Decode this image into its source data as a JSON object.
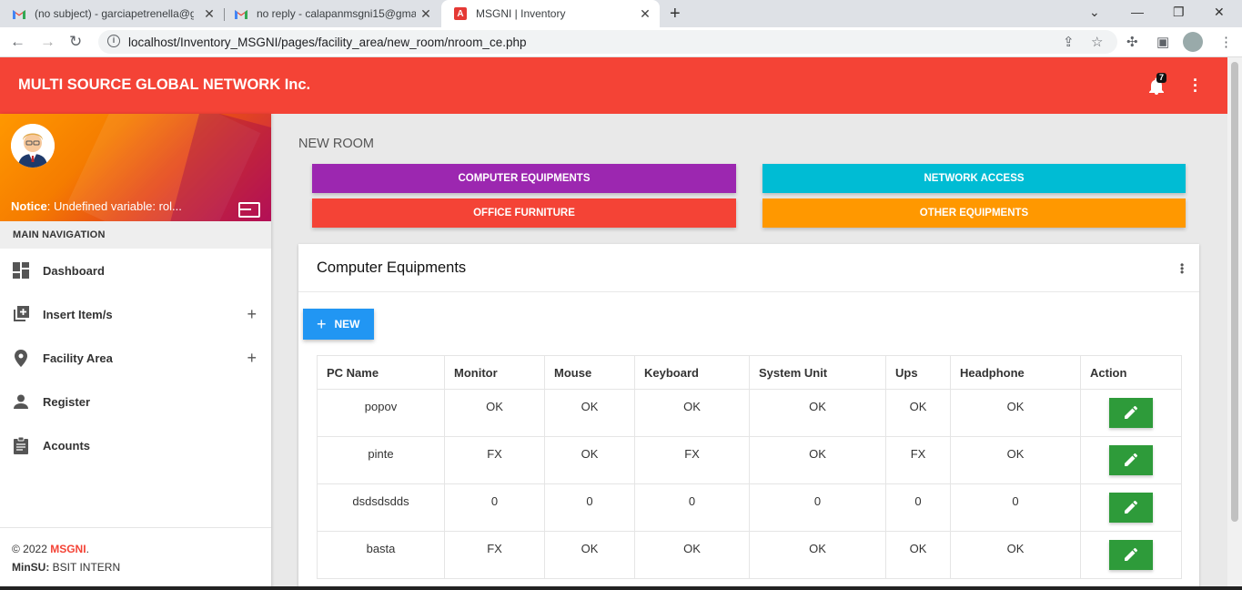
{
  "browser": {
    "tabs": [
      {
        "title": "(no subject) - garciapetrenella@g",
        "icon": "gmail-icon"
      },
      {
        "title": "no reply - calapanmsgni15@gma",
        "icon": "gmail-icon"
      },
      {
        "title": "MSGNI | Inventory",
        "icon": "app-favicon",
        "active": true
      }
    ],
    "url": "localhost/Inventory_MSGNI/pages/facility_area/new_room/nroom_ce.php"
  },
  "header": {
    "brand": "MULTI SOURCE GLOBAL NETWORK Inc.",
    "notification_count": "7",
    "color": "#f44336"
  },
  "sidebar": {
    "notice_label": "Notice",
    "notice_text": ": Undefined variable: rol...",
    "nav_header": "MAIN NAVIGATION",
    "items": [
      {
        "label": "Dashboard",
        "icon": "dashboard-icon",
        "expandable": false
      },
      {
        "label": "Insert Item/s",
        "icon": "library-add-icon",
        "expandable": true
      },
      {
        "label": "Facility Area",
        "icon": "location-pin-icon",
        "expandable": true
      },
      {
        "label": "Register",
        "icon": "person-icon",
        "expandable": false
      },
      {
        "label": "Acounts",
        "icon": "clipboard-icon",
        "expandable": false
      }
    ],
    "footer": {
      "copyright": "© 2022 ",
      "brand": "MSGNI",
      "period": ".",
      "school_label": "MinSU:",
      "school_text": " BSIT INTERN"
    }
  },
  "main": {
    "page_title": "NEW ROOM",
    "categories": [
      {
        "label": "COMPUTER EQUIPMENTS",
        "color": "#9c27b0"
      },
      {
        "label": "NETWORK ACCESS",
        "color": "#00bcd4"
      },
      {
        "label": "OFFICE FURNITURE",
        "color": "#f44336"
      },
      {
        "label": "OTHER EQUIPMENTS",
        "color": "#ff9800"
      }
    ],
    "card": {
      "title": "Computer Equipments",
      "new_button": "NEW",
      "columns": [
        "PC Name",
        "Monitor",
        "Mouse",
        "Keyboard",
        "System Unit",
        "Ups",
        "Headphone",
        "Action"
      ],
      "rows": [
        [
          "popov",
          "OK",
          "OK",
          "OK",
          "OK",
          "OK",
          "OK"
        ],
        [
          "pinte",
          "FX",
          "OK",
          "FX",
          "OK",
          "FX",
          "OK"
        ],
        [
          "dsdsdsdds",
          "0",
          "0",
          "0",
          "0",
          "0",
          "0"
        ],
        [
          "basta",
          "FX",
          "OK",
          "OK",
          "OK",
          "OK",
          "OK"
        ]
      ],
      "action_icon": "edit-pencil-icon",
      "action_color": "#2e9b3a"
    }
  }
}
